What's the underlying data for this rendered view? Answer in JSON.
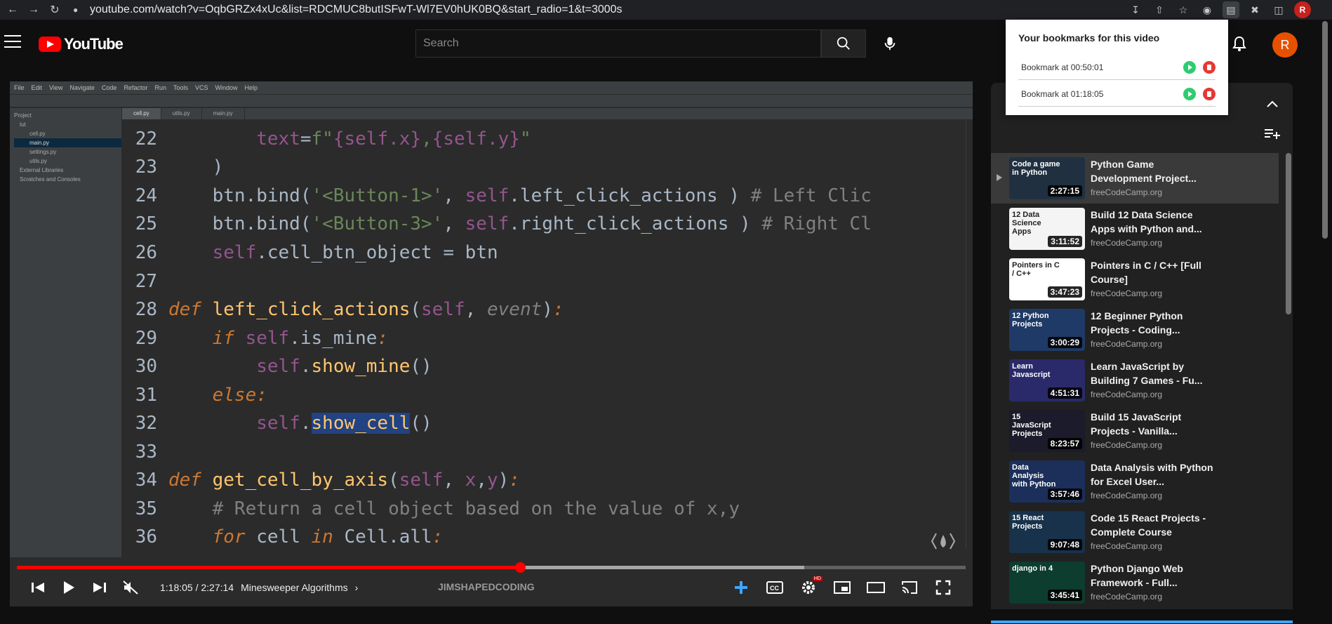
{
  "browser": {
    "url": "youtube.com/watch?v=OqbGRZx4xUc&list=RDCMUC8butISFwT-Wl7EV0hUK0BQ&start_radio=1&t=3000s",
    "profile_initial": "R"
  },
  "header": {
    "logo_text": "YouTube",
    "search_placeholder": "Search",
    "avatar_initial": "R"
  },
  "bookmarks_popup": {
    "title": "Your bookmarks for this video",
    "items": [
      {
        "label": "Bookmark at 00:50:01"
      },
      {
        "label": "Bookmark at 01:18:05"
      }
    ]
  },
  "ide": {
    "menu": [
      "File",
      "Edit",
      "View",
      "Navigate",
      "Code",
      "Refactor",
      "Run",
      "Tools",
      "VCS",
      "Window",
      "Help"
    ],
    "project_items": [
      "Project",
      "tut",
      "cell.py",
      "main.py",
      "settings.py",
      "utils.py",
      "External Libraries",
      "Scratches and Consoles"
    ],
    "file_tabs": [
      "cell.py",
      "utils.py",
      "main.py"
    ]
  },
  "editor_lines": [
    {
      "n": "22"
    },
    {
      "n": "23"
    },
    {
      "n": "24"
    },
    {
      "n": "25"
    },
    {
      "n": "26"
    },
    {
      "n": "27"
    },
    {
      "n": "28"
    },
    {
      "n": "29"
    },
    {
      "n": "30"
    },
    {
      "n": "31"
    },
    {
      "n": "32"
    },
    {
      "n": "33"
    },
    {
      "n": "34"
    },
    {
      "n": "35"
    },
    {
      "n": "36"
    }
  ],
  "player": {
    "time": "1:18:05 / 2:27:14",
    "chapter": "Minesweeper Algorithms",
    "brand": "JIMSHAPEDCODING",
    "hd_badge": "HD",
    "progress_fraction": 0.53,
    "buffered_fraction": 0.83
  },
  "playlist": [
    {
      "title": "Python Game Development Project...",
      "channel": "freeCodeCamp.org",
      "duration": "2:27:15",
      "thumb_text": "Code a game in Python",
      "thumb_color": "#203040",
      "active": true
    },
    {
      "title": "Build 12 Data Science Apps with Python and...",
      "channel": "freeCodeCamp.org",
      "duration": "3:11:52",
      "thumb_text": "12 Data Science Apps",
      "thumb_color": "#f4f4f4",
      "active": false
    },
    {
      "title": "Pointers in C / C++ [Full Course]",
      "channel": "freeCodeCamp.org",
      "duration": "3:47:23",
      "thumb_text": "Pointers in C / C++",
      "thumb_color": "#ffffff",
      "active": false
    },
    {
      "title": "12 Beginner Python Projects - Coding...",
      "channel": "freeCodeCamp.org",
      "duration": "3:00:29",
      "thumb_text": "12 Python Projects",
      "thumb_color": "#1f3a66",
      "active": false
    },
    {
      "title": "Learn JavaScript by Building 7 Games - Fu...",
      "channel": "freeCodeCamp.org",
      "duration": "4:51:31",
      "thumb_text": "Learn Javascript",
      "thumb_color": "#2a2a6a",
      "active": false
    },
    {
      "title": "Build 15 JavaScript Projects - Vanilla...",
      "channel": "freeCodeCamp.org",
      "duration": "8:23:57",
      "thumb_text": "15 JavaScript Projects",
      "thumb_color": "#1b1b2b",
      "active": false
    },
    {
      "title": "Data Analysis with Python for Excel User...",
      "channel": "freeCodeCamp.org",
      "duration": "3:57:46",
      "thumb_text": "Data Analysis with Python",
      "thumb_color": "#1c2f5a",
      "active": false
    },
    {
      "title": "Code 15 React Projects - Complete Course",
      "channel": "freeCodeCamp.org",
      "duration": "9:07:48",
      "thumb_text": "15 React Projects",
      "thumb_color": "#17324a",
      "active": false
    },
    {
      "title": "Python Django Web Framework - Full...",
      "channel": "freeCodeCamp.org",
      "duration": "3:45:41",
      "thumb_text": "django in 4",
      "thumb_color": "#0c3d2e",
      "active": false
    }
  ],
  "colors": {
    "accent": "#ff0000",
    "link": "#3ea6ff"
  }
}
